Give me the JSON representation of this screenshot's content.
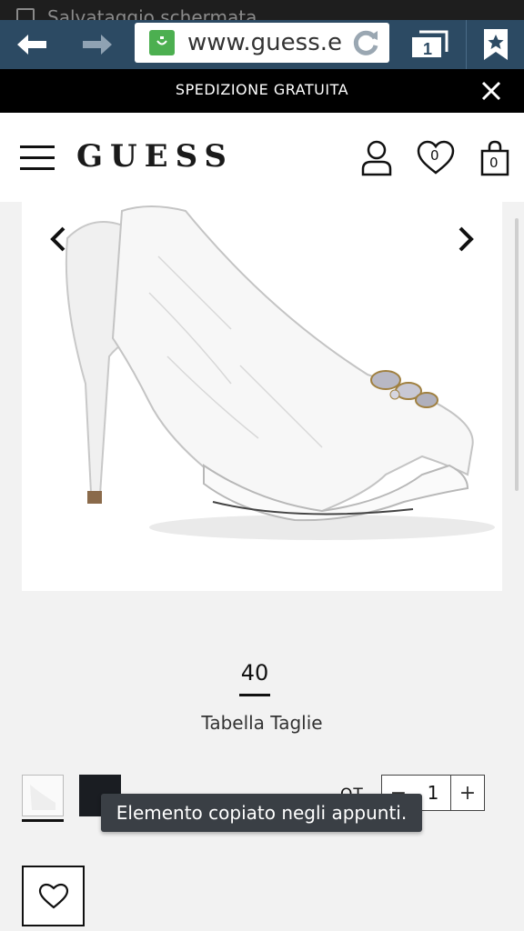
{
  "status_bar": {
    "notification_text": "Salvataggio schermata"
  },
  "browser": {
    "url": "www.guess.e",
    "tab_count": "1"
  },
  "promo": {
    "text": "SPEDIZIONE GRATUITA"
  },
  "header": {
    "logo": "GUESS",
    "wishlist_count": "0",
    "cart_count": "0"
  },
  "product": {
    "size": "40",
    "size_chart_label": "Tabella Taglie",
    "qty_label": "QT.",
    "qty_minus": "−",
    "qty_value": "1",
    "qty_plus": "+"
  },
  "toast": {
    "text": "Elemento copiato negli appunti."
  },
  "colors": {
    "browser_bar": "#2c4a63",
    "promo_bg": "#000000",
    "favicon": "#4caf50"
  }
}
